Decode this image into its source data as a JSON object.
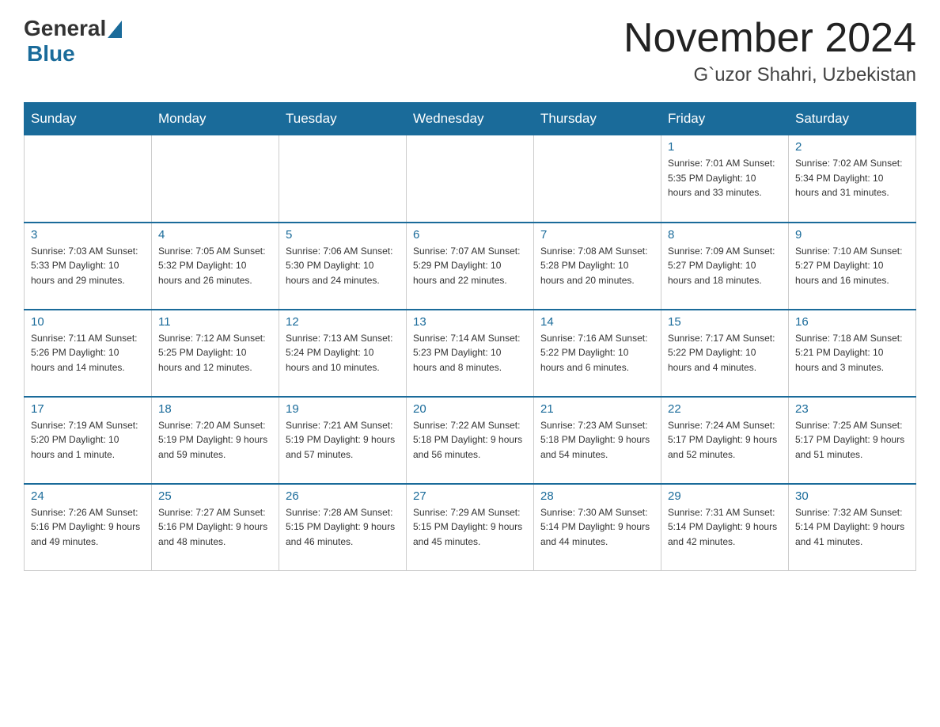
{
  "header": {
    "logo": {
      "general": "General",
      "triangle_color": "#1a6b9a",
      "blue": "Blue"
    },
    "title": "November 2024",
    "location": "G`uzor Shahri, Uzbekistan"
  },
  "calendar": {
    "days_of_week": [
      "Sunday",
      "Monday",
      "Tuesday",
      "Wednesday",
      "Thursday",
      "Friday",
      "Saturday"
    ],
    "weeks": [
      [
        {
          "day": "",
          "info": ""
        },
        {
          "day": "",
          "info": ""
        },
        {
          "day": "",
          "info": ""
        },
        {
          "day": "",
          "info": ""
        },
        {
          "day": "",
          "info": ""
        },
        {
          "day": "1",
          "info": "Sunrise: 7:01 AM\nSunset: 5:35 PM\nDaylight: 10 hours\nand 33 minutes."
        },
        {
          "day": "2",
          "info": "Sunrise: 7:02 AM\nSunset: 5:34 PM\nDaylight: 10 hours\nand 31 minutes."
        }
      ],
      [
        {
          "day": "3",
          "info": "Sunrise: 7:03 AM\nSunset: 5:33 PM\nDaylight: 10 hours\nand 29 minutes."
        },
        {
          "day": "4",
          "info": "Sunrise: 7:05 AM\nSunset: 5:32 PM\nDaylight: 10 hours\nand 26 minutes."
        },
        {
          "day": "5",
          "info": "Sunrise: 7:06 AM\nSunset: 5:30 PM\nDaylight: 10 hours\nand 24 minutes."
        },
        {
          "day": "6",
          "info": "Sunrise: 7:07 AM\nSunset: 5:29 PM\nDaylight: 10 hours\nand 22 minutes."
        },
        {
          "day": "7",
          "info": "Sunrise: 7:08 AM\nSunset: 5:28 PM\nDaylight: 10 hours\nand 20 minutes."
        },
        {
          "day": "8",
          "info": "Sunrise: 7:09 AM\nSunset: 5:27 PM\nDaylight: 10 hours\nand 18 minutes."
        },
        {
          "day": "9",
          "info": "Sunrise: 7:10 AM\nSunset: 5:27 PM\nDaylight: 10 hours\nand 16 minutes."
        }
      ],
      [
        {
          "day": "10",
          "info": "Sunrise: 7:11 AM\nSunset: 5:26 PM\nDaylight: 10 hours\nand 14 minutes."
        },
        {
          "day": "11",
          "info": "Sunrise: 7:12 AM\nSunset: 5:25 PM\nDaylight: 10 hours\nand 12 minutes."
        },
        {
          "day": "12",
          "info": "Sunrise: 7:13 AM\nSunset: 5:24 PM\nDaylight: 10 hours\nand 10 minutes."
        },
        {
          "day": "13",
          "info": "Sunrise: 7:14 AM\nSunset: 5:23 PM\nDaylight: 10 hours\nand 8 minutes."
        },
        {
          "day": "14",
          "info": "Sunrise: 7:16 AM\nSunset: 5:22 PM\nDaylight: 10 hours\nand 6 minutes."
        },
        {
          "day": "15",
          "info": "Sunrise: 7:17 AM\nSunset: 5:22 PM\nDaylight: 10 hours\nand 4 minutes."
        },
        {
          "day": "16",
          "info": "Sunrise: 7:18 AM\nSunset: 5:21 PM\nDaylight: 10 hours\nand 3 minutes."
        }
      ],
      [
        {
          "day": "17",
          "info": "Sunrise: 7:19 AM\nSunset: 5:20 PM\nDaylight: 10 hours\nand 1 minute."
        },
        {
          "day": "18",
          "info": "Sunrise: 7:20 AM\nSunset: 5:19 PM\nDaylight: 9 hours\nand 59 minutes."
        },
        {
          "day": "19",
          "info": "Sunrise: 7:21 AM\nSunset: 5:19 PM\nDaylight: 9 hours\nand 57 minutes."
        },
        {
          "day": "20",
          "info": "Sunrise: 7:22 AM\nSunset: 5:18 PM\nDaylight: 9 hours\nand 56 minutes."
        },
        {
          "day": "21",
          "info": "Sunrise: 7:23 AM\nSunset: 5:18 PM\nDaylight: 9 hours\nand 54 minutes."
        },
        {
          "day": "22",
          "info": "Sunrise: 7:24 AM\nSunset: 5:17 PM\nDaylight: 9 hours\nand 52 minutes."
        },
        {
          "day": "23",
          "info": "Sunrise: 7:25 AM\nSunset: 5:17 PM\nDaylight: 9 hours\nand 51 minutes."
        }
      ],
      [
        {
          "day": "24",
          "info": "Sunrise: 7:26 AM\nSunset: 5:16 PM\nDaylight: 9 hours\nand 49 minutes."
        },
        {
          "day": "25",
          "info": "Sunrise: 7:27 AM\nSunset: 5:16 PM\nDaylight: 9 hours\nand 48 minutes."
        },
        {
          "day": "26",
          "info": "Sunrise: 7:28 AM\nSunset: 5:15 PM\nDaylight: 9 hours\nand 46 minutes."
        },
        {
          "day": "27",
          "info": "Sunrise: 7:29 AM\nSunset: 5:15 PM\nDaylight: 9 hours\nand 45 minutes."
        },
        {
          "day": "28",
          "info": "Sunrise: 7:30 AM\nSunset: 5:14 PM\nDaylight: 9 hours\nand 44 minutes."
        },
        {
          "day": "29",
          "info": "Sunrise: 7:31 AM\nSunset: 5:14 PM\nDaylight: 9 hours\nand 42 minutes."
        },
        {
          "day": "30",
          "info": "Sunrise: 7:32 AM\nSunset: 5:14 PM\nDaylight: 9 hours\nand 41 minutes."
        }
      ]
    ]
  }
}
